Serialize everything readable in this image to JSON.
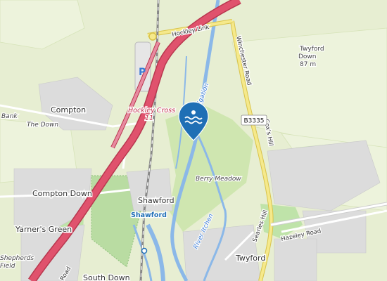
{
  "map": {
    "places": {
      "compton": "Compton",
      "compton_down": "Compton Down",
      "yarners_green": "Yarner's Green",
      "shawford": "Shawford",
      "shawford_station": "Shawford",
      "twyford": "Twyford",
      "twyford_down": "Twyford\nDown",
      "twyford_down_elev": "87 m",
      "south_down": "South Down",
      "shepherds_field": "Shepherds\nField",
      "bank": "Bank",
      "the_down": "The Down",
      "berry_meadow": "Berry Meadow"
    },
    "roads": {
      "hockley_link": "Hockley Link",
      "winchester_road": "Winchester Road",
      "coxs_hill": "Cox's Hill",
      "searles_hill": "Searles Hill",
      "hazeley_road": "Hazeley Road",
      "b3335": "B3335",
      "road_partial": "Road"
    },
    "junction": {
      "name": "Hockley Cross",
      "number": "11"
    },
    "water": {
      "river_itchen": "River Itchen",
      "navigation": "Navigation"
    },
    "icons": {
      "parking": "P",
      "marker": "swimming-pin-icon"
    },
    "colors": {
      "motorway": "#e0526d",
      "water": "#8bb8e8",
      "forest": "#b7d9a1",
      "residential": "#d9d9d9",
      "pin": "#1f6fb5"
    }
  }
}
